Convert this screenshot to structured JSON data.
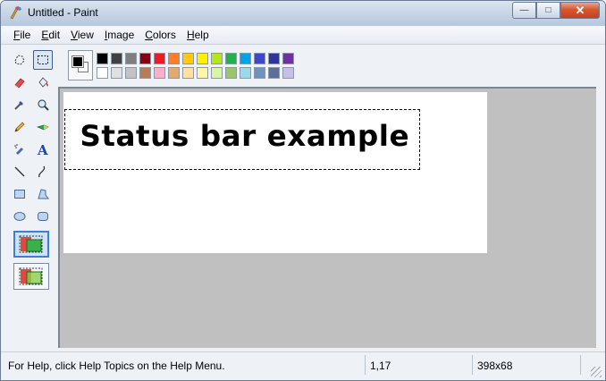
{
  "window": {
    "title": "Untitled - Paint"
  },
  "window_buttons": {
    "minimize": "—",
    "maximize": "□",
    "close": "✕"
  },
  "menu": [
    {
      "label": "File",
      "mnemonic": "F",
      "rest": "ile"
    },
    {
      "label": "Edit",
      "mnemonic": "E",
      "rest": "dit"
    },
    {
      "label": "View",
      "mnemonic": "V",
      "rest": "iew"
    },
    {
      "label": "Image",
      "mnemonic": "I",
      "rest": "mage"
    },
    {
      "label": "Colors",
      "mnemonic": "C",
      "rest": "olors"
    },
    {
      "label": "Help",
      "mnemonic": "H",
      "rest": "elp"
    }
  ],
  "tools": [
    "free-form-select",
    "select",
    "eraser",
    "fill-with-color",
    "pick-color",
    "magnifier",
    "pencil",
    "brush",
    "airbrush",
    "text",
    "line",
    "curve",
    "rectangle",
    "polygon",
    "ellipse",
    "rounded-rectangle"
  ],
  "selected_tool": "select",
  "palette": {
    "foreground": "#000000",
    "background": "#ffffff",
    "row1": [
      "#000000",
      "#404040",
      "#7f7f7f",
      "#880015",
      "#ed1c24",
      "#ff7f27",
      "#ffc90e",
      "#fff200",
      "#b5e61d",
      "#22b14c",
      "#00a2e8",
      "#3f48cc",
      "#2f3699",
      "#7030a0"
    ],
    "row2": [
      "#ffffff",
      "#e0e0e0",
      "#c3c3c3",
      "#b97a57",
      "#ffaec9",
      "#e5a96b",
      "#ffe29f",
      "#fff5a6",
      "#d9f5a8",
      "#9ac56b",
      "#99d9ea",
      "#7092be",
      "#5c6f99",
      "#c8bfe7"
    ]
  },
  "canvas": {
    "text": "Status bar example"
  },
  "status": {
    "help": "For Help, click Help Topics on the Help Menu.",
    "coords": "1,17",
    "size": "398x68"
  }
}
